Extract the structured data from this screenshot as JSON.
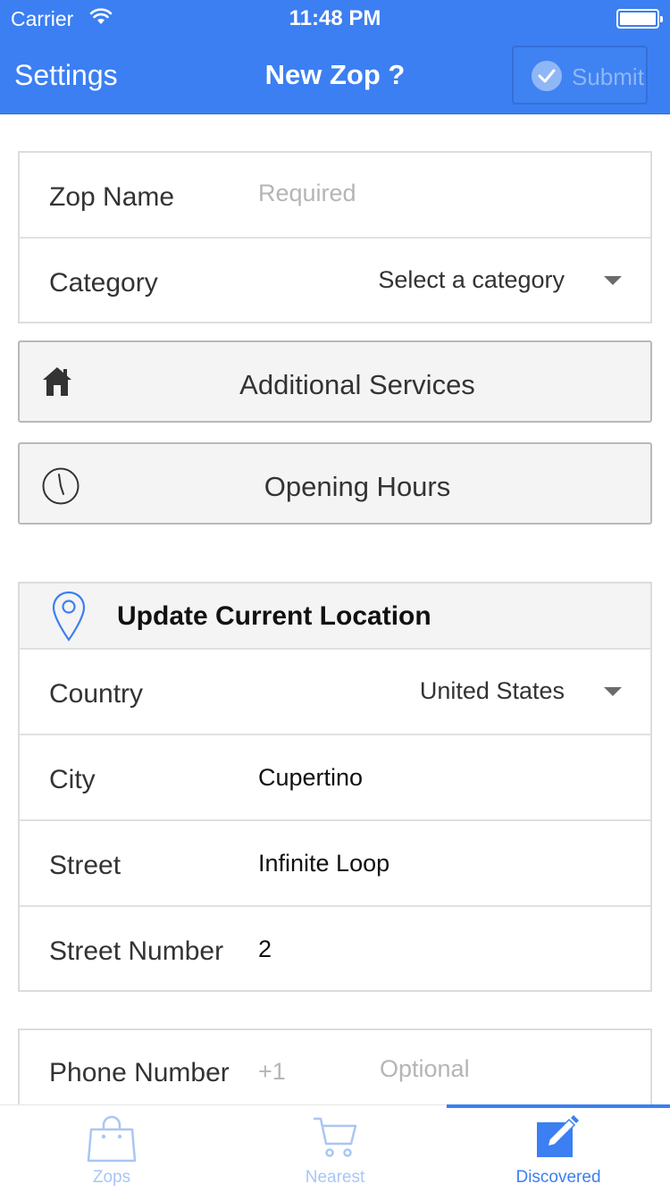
{
  "status_bar": {
    "carrier": "Carrier",
    "time": "11:48 PM"
  },
  "nav": {
    "back_label": "Settings",
    "title": "New Zop ?",
    "submit_label": "Submit"
  },
  "form": {
    "zop_name": {
      "label": "Zop Name",
      "placeholder": "Required"
    },
    "category": {
      "label": "Category",
      "value": "Select a category"
    }
  },
  "buttons": {
    "additional_services": "Additional Services",
    "opening_hours": "Opening Hours"
  },
  "location": {
    "header": "Update Current Location",
    "country": {
      "label": "Country",
      "value": "United States"
    },
    "city": {
      "label": "City",
      "value": "Cupertino"
    },
    "street": {
      "label": "Street",
      "value": "Infinite Loop"
    },
    "street_number": {
      "label": "Street Number",
      "value": "2"
    }
  },
  "phone": {
    "label": "Phone Number",
    "prefix": "+1",
    "placeholder": "Optional"
  },
  "tabs": [
    {
      "label": "Zops",
      "icon": "shopping-bag-icon",
      "active": false
    },
    {
      "label": "Nearest",
      "icon": "cart-icon",
      "active": false
    },
    {
      "label": "Discovered",
      "icon": "edit-icon",
      "active": true
    }
  ],
  "colors": {
    "accent": "#3b7ff2",
    "inactive_tab": "#a9c6f5"
  }
}
